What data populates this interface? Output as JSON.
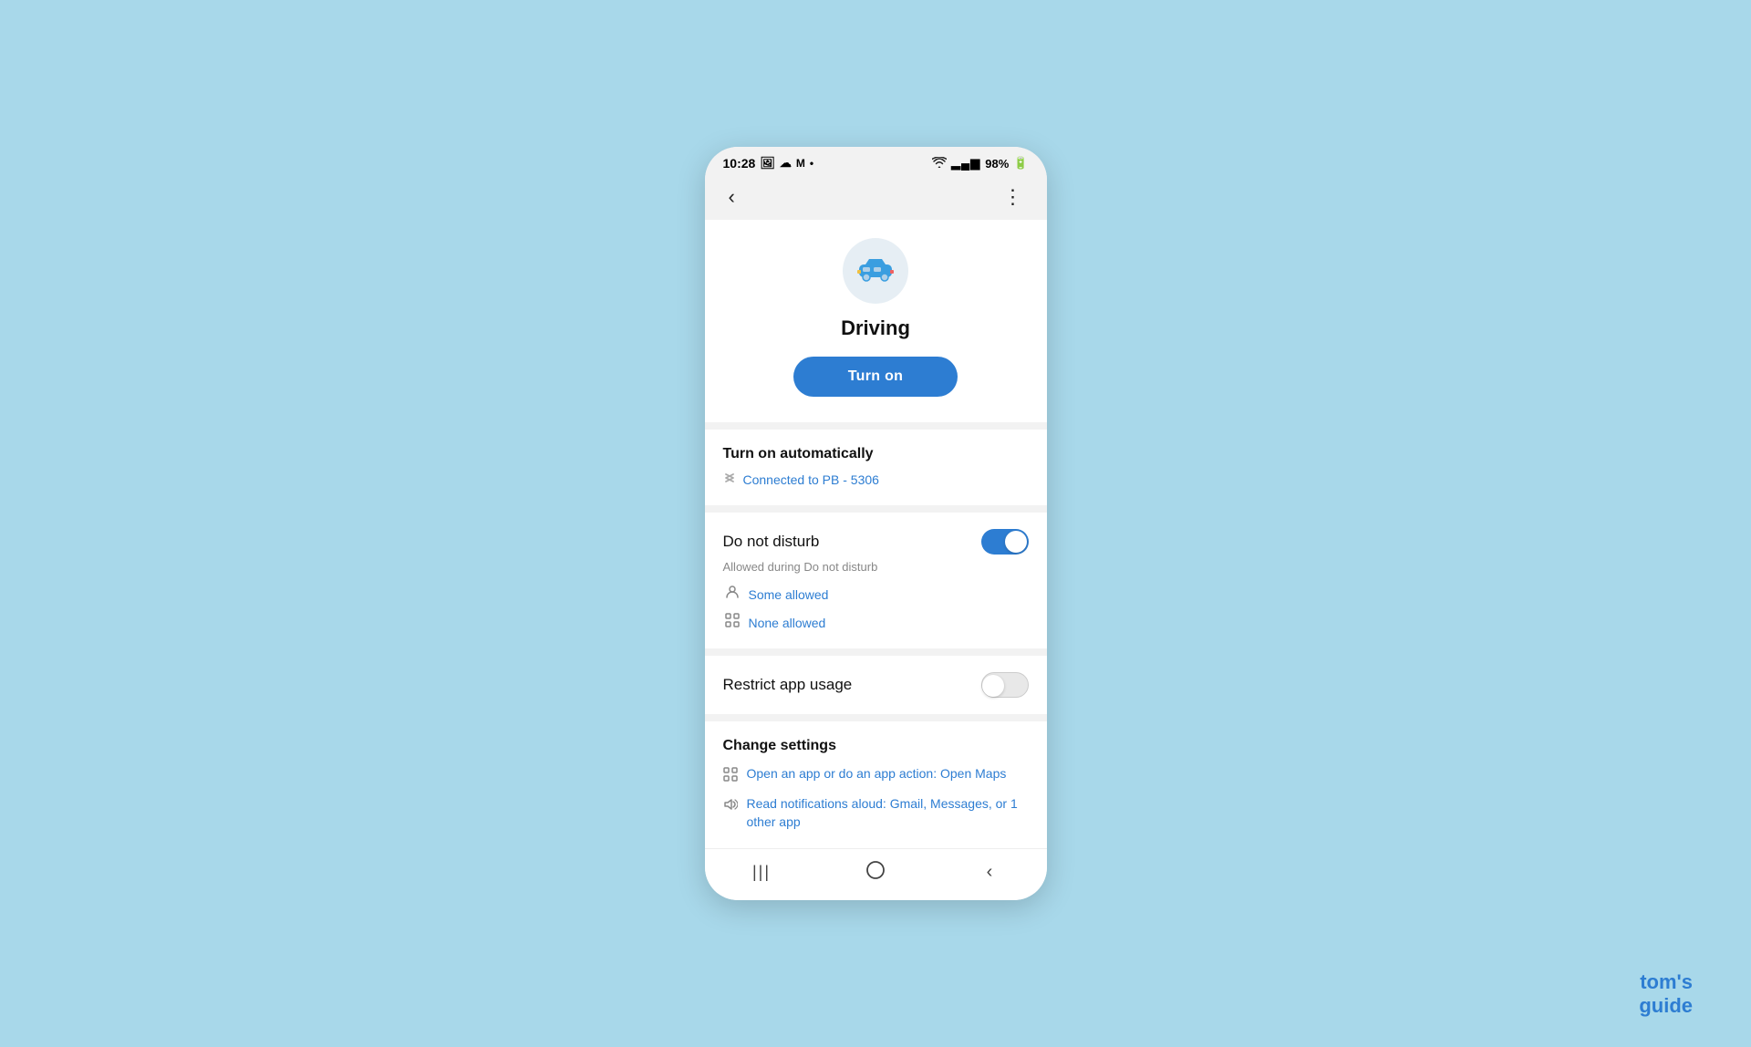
{
  "statusBar": {
    "time": "10:28",
    "battery": "98%"
  },
  "nav": {
    "backIcon": "‹",
    "menuIcon": "⋮"
  },
  "hero": {
    "title": "Driving",
    "turnOnButton": "Turn on"
  },
  "autoSection": {
    "title": "Turn on automatically",
    "item": "Connected to PB - 5306"
  },
  "dndSection": {
    "label": "Do not disturb",
    "subLabel": "Allowed during Do not disturb",
    "toggleOn": true,
    "items": [
      {
        "icon": "person",
        "label": "Some allowed"
      },
      {
        "icon": "apps",
        "label": "None allowed"
      }
    ]
  },
  "restrictSection": {
    "label": "Restrict app usage",
    "toggleOn": false
  },
  "changeSettings": {
    "title": "Change settings",
    "items": [
      {
        "icon": "apps",
        "label": "Open an app or do an app action: Open Maps"
      },
      {
        "icon": "volume",
        "label": "Read notifications aloud: Gmail, Messages, or 1 other app"
      }
    ]
  },
  "bottomNav": {
    "items": [
      "|||",
      "○",
      "‹"
    ]
  },
  "watermark": {
    "toms": "tom's",
    "guide": "guide"
  }
}
